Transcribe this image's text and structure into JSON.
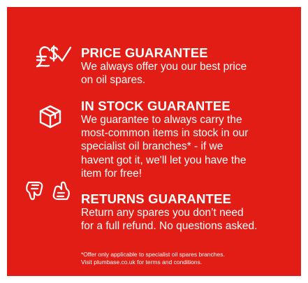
{
  "colors": {
    "panel": "#e11d16",
    "text": "#ffffff"
  },
  "guarantees": [
    {
      "icon": "currency-check-icon",
      "title": "PRICE GUARANTEE",
      "body": "We always offer you our best price\non oil spares."
    },
    {
      "icon": "box-icon",
      "title": "IN STOCK GUARANTEE",
      "body": "We guarantee to always carry the\nmost-common items in stock in our\nspecialist oil  branches* - if we\nhavent got it, we'll let you have the\nitem for free!"
    },
    {
      "icon": "thumbs-up-down-icon",
      "title": "RETURNS GUARANTEE",
      "body": "Return any spares you don’t need\nfor a full refund. No questions asked."
    }
  ],
  "footnote": "*Offer only applicable to specialist oil spares branches.\nVisit plumbase.co.uk for terms and conditions."
}
